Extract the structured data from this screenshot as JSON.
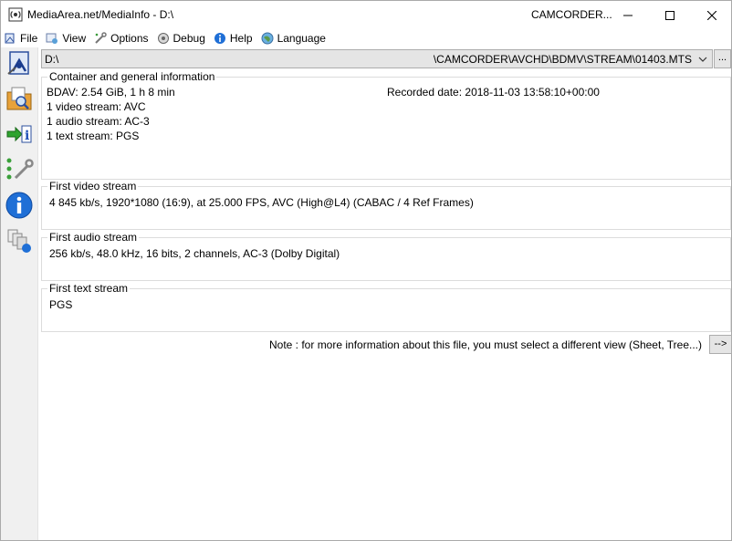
{
  "window": {
    "title": "MediaArea.net/MediaInfo - D:\\",
    "title_right": "CAMCORDER..."
  },
  "menu": {
    "items": [
      {
        "label": "File",
        "icon": "file-icon"
      },
      {
        "label": "View",
        "icon": "view-icon"
      },
      {
        "label": "Options",
        "icon": "options-icon"
      },
      {
        "label": "Debug",
        "icon": "debug-icon"
      },
      {
        "label": "Help",
        "icon": "help-icon"
      },
      {
        "label": "Language",
        "icon": "language-icon"
      }
    ]
  },
  "sidebar": {
    "buttons": [
      "open-file-icon",
      "open-folder-icon",
      "export-icon",
      "preferences-icon",
      "about-icon",
      "knowledge-base-icon"
    ]
  },
  "path": {
    "left": "D:\\",
    "right": "\\CAMCORDER\\AVCHD\\BDMV\\STREAM\\01403.MTS",
    "browse_label": "..."
  },
  "general": {
    "title": "Container and general information",
    "format_line": "BDAV: 2.54 GiB, 1 h 8 min",
    "recorded_date": "Recorded date: 2018-11-03 13:58:10+00:00",
    "video_count": "1 video stream: AVC",
    "audio_count": "1 audio stream: AC-3",
    "text_count": "1 text stream: PGS"
  },
  "video": {
    "title": "First video stream",
    "info": "4 845 kb/s, 1920*1080 (16:9), at 25.000 FPS, AVC (High@L4) (CABAC / 4 Ref Frames)"
  },
  "audio": {
    "title": "First audio stream",
    "info": "256 kb/s, 48.0 kHz, 16 bits, 2 channels, AC-3 (Dolby Digital)"
  },
  "text": {
    "title": "First text stream",
    "info": "PGS"
  },
  "note": {
    "text": "Note : for more information about this file, you must select a different view (Sheet, Tree...)",
    "button_label": "-->"
  }
}
